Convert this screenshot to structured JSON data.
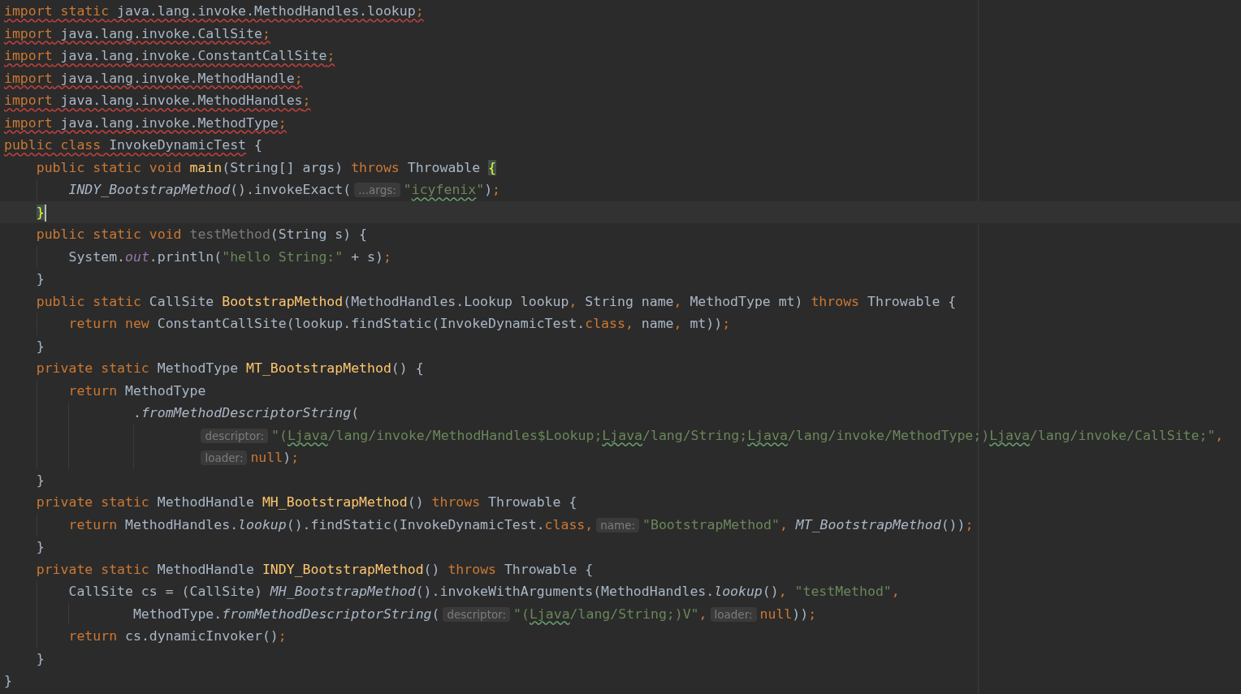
{
  "editor": {
    "lines": [
      {
        "tokens": [
          {
            "text": "import",
            "kind": "keyword",
            "error": true
          },
          {
            "text": " static",
            "kind": "keyword",
            "error": true
          },
          {
            "text": " java.lang.invoke.MethodHandles.lookup",
            "kind": "plain",
            "error": true
          },
          {
            "text": ";",
            "kind": "keyword",
            "error": true
          }
        ]
      },
      {
        "tokens": [
          {
            "text": "import",
            "kind": "keyword",
            "error": true
          },
          {
            "text": " java.lang.invoke.CallSite",
            "kind": "plain",
            "error": true
          },
          {
            "text": ";",
            "kind": "keyword",
            "error": true
          }
        ]
      },
      {
        "tokens": [
          {
            "text": "import",
            "kind": "keyword",
            "error": true
          },
          {
            "text": " java.lang.invoke.ConstantCallSite",
            "kind": "plain",
            "error": true
          },
          {
            "text": ";",
            "kind": "keyword",
            "error": true
          }
        ]
      },
      {
        "tokens": [
          {
            "text": "import",
            "kind": "keyword",
            "error": true
          },
          {
            "text": " java.lang.invoke.MethodHandle",
            "kind": "plain",
            "error": true
          },
          {
            "text": ";",
            "kind": "keyword",
            "error": true
          }
        ]
      },
      {
        "tokens": [
          {
            "text": "import",
            "kind": "keyword",
            "error": true
          },
          {
            "text": " java.lang.invoke.MethodHandles",
            "kind": "plain",
            "error": true
          },
          {
            "text": ";",
            "kind": "keyword",
            "error": true
          }
        ]
      },
      {
        "tokens": [
          {
            "text": "import",
            "kind": "keyword",
            "error": true
          },
          {
            "text": " java.lang.invoke.MethodType",
            "kind": "plain",
            "error": true
          },
          {
            "text": ";",
            "kind": "keyword",
            "error": true
          }
        ]
      },
      {
        "tokens": [
          {
            "text": "public class",
            "kind": "keyword",
            "error": true
          },
          {
            "text": " InvokeDynamicTest",
            "kind": "plain",
            "error": true
          },
          {
            "text": " {",
            "kind": "plain"
          }
        ],
        "children": [
          {
            "tokens": [
              {
                "text": "public static void",
                "kind": "keyword"
              },
              {
                "text": " main",
                "kind": "declaration"
              },
              {
                "text": "(String[] args) ",
                "kind": "plain"
              },
              {
                "text": "throws",
                "kind": "keyword"
              },
              {
                "text": " Throwable ",
                "kind": "plain"
              },
              {
                "text": "{",
                "kind": "brace-match"
              }
            ],
            "children": [
              {
                "tokens": [
                  {
                    "text": "INDY_BootstrapMethod",
                    "kind": "static-call"
                  },
                  {
                    "text": "().invokeExact(",
                    "kind": "plain"
                  },
                  {
                    "text": "...args:",
                    "kind": "hint"
                  },
                  {
                    "text": "\"",
                    "kind": "string"
                  },
                  {
                    "text": "icyfenix",
                    "kind": "string",
                    "typo": true
                  },
                  {
                    "text": "\"",
                    "kind": "string"
                  },
                  {
                    "text": ")",
                    "kind": "plain"
                  },
                  {
                    "text": ";",
                    "kind": "keyword"
                  }
                ]
              }
            ]
          },
          {
            "tokens": [
              {
                "text": "}",
                "kind": "brace-match"
              }
            ],
            "current": true
          },
          {
            "tokens": [
              {
                "text": "public static void",
                "kind": "keyword"
              },
              {
                "text": " testMethod",
                "kind": "unused"
              },
              {
                "text": "(String s) {",
                "kind": "plain"
              }
            ],
            "children": [
              {
                "tokens": [
                  {
                    "text": "System.",
                    "kind": "plain"
                  },
                  {
                    "text": "out",
                    "kind": "static-field"
                  },
                  {
                    "text": ".println(",
                    "kind": "plain"
                  },
                  {
                    "text": "\"hello String:\"",
                    "kind": "string"
                  },
                  {
                    "text": " + s)",
                    "kind": "plain"
                  },
                  {
                    "text": ";",
                    "kind": "keyword"
                  }
                ]
              }
            ]
          },
          {
            "tokens": [
              {
                "text": "}",
                "kind": "plain"
              }
            ]
          },
          {
            "tokens": [
              {
                "text": "public static",
                "kind": "keyword"
              },
              {
                "text": " CallSite ",
                "kind": "plain"
              },
              {
                "text": "BootstrapMethod",
                "kind": "declaration"
              },
              {
                "text": "(MethodHandles.Lookup lookup",
                "kind": "plain"
              },
              {
                "text": ",",
                "kind": "keyword"
              },
              {
                "text": " String name",
                "kind": "plain"
              },
              {
                "text": ",",
                "kind": "keyword"
              },
              {
                "text": " MethodType mt) ",
                "kind": "plain"
              },
              {
                "text": "throws",
                "kind": "keyword"
              },
              {
                "text": " Throwable {",
                "kind": "plain"
              }
            ],
            "children": [
              {
                "tokens": [
                  {
                    "text": "return new",
                    "kind": "keyword"
                  },
                  {
                    "text": " ConstantCallSite(lookup.findStatic(InvokeDynamicTest.",
                    "kind": "plain"
                  },
                  {
                    "text": "class,",
                    "kind": "keyword"
                  },
                  {
                    "text": " name",
                    "kind": "plain"
                  },
                  {
                    "text": ",",
                    "kind": "keyword"
                  },
                  {
                    "text": " mt))",
                    "kind": "plain"
                  },
                  {
                    "text": ";",
                    "kind": "keyword"
                  }
                ]
              }
            ]
          },
          {
            "tokens": [
              {
                "text": "}",
                "kind": "plain"
              }
            ]
          },
          {
            "tokens": [
              {
                "text": "private static",
                "kind": "keyword"
              },
              {
                "text": " MethodType ",
                "kind": "plain"
              },
              {
                "text": "MT_BootstrapMethod",
                "kind": "declaration"
              },
              {
                "text": "() {",
                "kind": "plain"
              }
            ],
            "children": [
              {
                "tokens": [
                  {
                    "text": "return",
                    "kind": "keyword"
                  },
                  {
                    "text": " MethodType",
                    "kind": "plain"
                  }
                ],
                "children": [
                  {
                    "kind": "continuation",
                    "tokens": [
                      {
                        "text": ".",
                        "kind": "plain"
                      },
                      {
                        "text": "fromMethodDescriptorString",
                        "kind": "static-call"
                      },
                      {
                        "text": "(",
                        "kind": "plain"
                      }
                    ],
                    "children": [
                      {
                        "kind": "continuation",
                        "tokens": [
                          {
                            "text": "descriptor:",
                            "kind": "hint"
                          },
                          {
                            "text": "\"(",
                            "kind": "string"
                          },
                          {
                            "text": "Ljava",
                            "kind": "string",
                            "typo": true
                          },
                          {
                            "text": "/lang/invoke/MethodHandles$Lookup;",
                            "kind": "string"
                          },
                          {
                            "text": "Ljava",
                            "kind": "string",
                            "typo": true
                          },
                          {
                            "text": "/lang/String;",
                            "kind": "string"
                          },
                          {
                            "text": "Ljava",
                            "kind": "string",
                            "typo": true
                          },
                          {
                            "text": "/lang/invoke/MethodType;)",
                            "kind": "string"
                          },
                          {
                            "text": "Ljava",
                            "kind": "string",
                            "typo": true
                          },
                          {
                            "text": "/lang/invoke/CallSite;\"",
                            "kind": "string"
                          },
                          {
                            "text": ",",
                            "kind": "keyword"
                          }
                        ]
                      },
                      {
                        "kind": "continuation",
                        "tokens": [
                          {
                            "text": "loader:",
                            "kind": "hint"
                          },
                          {
                            "text": "null",
                            "kind": "keyword"
                          },
                          {
                            "text": ")",
                            "kind": "plain"
                          },
                          {
                            "text": ";",
                            "kind": "keyword"
                          }
                        ]
                      }
                    ]
                  }
                ]
              }
            ]
          },
          {
            "tokens": [
              {
                "text": "}",
                "kind": "plain"
              }
            ]
          },
          {
            "tokens": [
              {
                "text": "private static",
                "kind": "keyword"
              },
              {
                "text": " MethodHandle ",
                "kind": "plain"
              },
              {
                "text": "MH_BootstrapMethod",
                "kind": "declaration"
              },
              {
                "text": "() ",
                "kind": "plain"
              },
              {
                "text": "throws",
                "kind": "keyword"
              },
              {
                "text": " Throwable {",
                "kind": "plain"
              }
            ],
            "children": [
              {
                "tokens": [
                  {
                    "text": "return",
                    "kind": "keyword"
                  },
                  {
                    "text": " MethodHandles.",
                    "kind": "plain"
                  },
                  {
                    "text": "lookup",
                    "kind": "static-call"
                  },
                  {
                    "text": "().findStatic(InvokeDynamicTest.",
                    "kind": "plain"
                  },
                  {
                    "text": "class,",
                    "kind": "keyword"
                  },
                  {
                    "text": "name:",
                    "kind": "hint"
                  },
                  {
                    "text": "\"BootstrapMethod\"",
                    "kind": "string"
                  },
                  {
                    "text": ",",
                    "kind": "keyword"
                  },
                  {
                    "text": " MT_BootstrapMethod",
                    "kind": "static-call"
                  },
                  {
                    "text": "())",
                    "kind": "plain"
                  },
                  {
                    "text": ";",
                    "kind": "keyword"
                  }
                ]
              }
            ]
          },
          {
            "tokens": [
              {
                "text": "}",
                "kind": "plain"
              }
            ]
          },
          {
            "tokens": [
              {
                "text": "private static",
                "kind": "keyword"
              },
              {
                "text": " MethodHandle ",
                "kind": "plain"
              },
              {
                "text": "INDY_BootstrapMethod",
                "kind": "declaration"
              },
              {
                "text": "() ",
                "kind": "plain"
              },
              {
                "text": "throws",
                "kind": "keyword"
              },
              {
                "text": " Throwable {",
                "kind": "plain"
              }
            ],
            "children": [
              {
                "tokens": [
                  {
                    "text": "CallSite cs = (CallSite) ",
                    "kind": "plain"
                  },
                  {
                    "text": "MH_BootstrapMethod",
                    "kind": "static-call"
                  },
                  {
                    "text": "().invokeWithArguments(MethodHandles.",
                    "kind": "plain"
                  },
                  {
                    "text": "lookup",
                    "kind": "static-call"
                  },
                  {
                    "text": "()",
                    "kind": "plain"
                  },
                  {
                    "text": ",",
                    "kind": "keyword"
                  },
                  {
                    "text": " \"testMethod\"",
                    "kind": "string"
                  },
                  {
                    "text": ",",
                    "kind": "keyword"
                  }
                ],
                "children": [
                  {
                    "kind": "continuation",
                    "tokens": [
                      {
                        "text": "MethodType.",
                        "kind": "plain"
                      },
                      {
                        "text": "fromMethodDescriptorString",
                        "kind": "static-call"
                      },
                      {
                        "text": "(",
                        "kind": "plain"
                      },
                      {
                        "text": "descriptor:",
                        "kind": "hint"
                      },
                      {
                        "text": "\"(",
                        "kind": "string"
                      },
                      {
                        "text": "Ljava",
                        "kind": "string",
                        "typo": true
                      },
                      {
                        "text": "/lang/String;)V\"",
                        "kind": "string"
                      },
                      {
                        "text": ",",
                        "kind": "keyword"
                      },
                      {
                        "text": "loader:",
                        "kind": "hint"
                      },
                      {
                        "text": "null",
                        "kind": "keyword"
                      },
                      {
                        "text": "))",
                        "kind": "plain"
                      },
                      {
                        "text": ";",
                        "kind": "keyword"
                      }
                    ]
                  }
                ]
              },
              {
                "tokens": [
                  {
                    "text": "return",
                    "kind": "keyword"
                  },
                  {
                    "text": " cs.dynamicInvoker()",
                    "kind": "plain"
                  },
                  {
                    "text": ";",
                    "kind": "keyword"
                  }
                ]
              }
            ]
          },
          {
            "tokens": [
              {
                "text": "}",
                "kind": "plain"
              }
            ]
          }
        ]
      },
      {
        "tokens": [
          {
            "text": "}",
            "kind": "plain"
          }
        ]
      }
    ]
  }
}
